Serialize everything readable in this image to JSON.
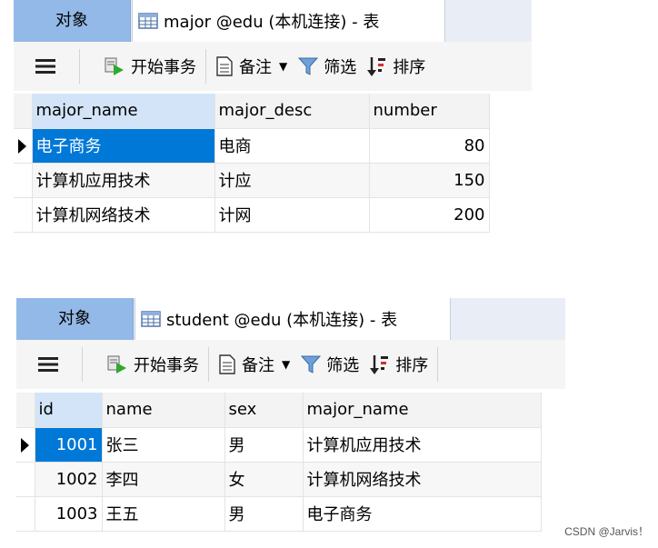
{
  "panel1": {
    "objects_tab": "对象",
    "table_tab": "major @edu (本机连接) - 表",
    "toolbar": {
      "begin_transaction": "开始事务",
      "notes": "备注",
      "filter": "筛选",
      "sort": "排序"
    },
    "columns": [
      "major_name",
      "major_desc",
      "number"
    ],
    "rows": [
      [
        "电子商务",
        "电商",
        "80"
      ],
      [
        "计算机应用技术",
        "计应",
        "150"
      ],
      [
        "计算机网络技术",
        "计网",
        "200"
      ]
    ]
  },
  "panel2": {
    "objects_tab": "对象",
    "table_tab": "student @edu (本机连接) - 表",
    "toolbar": {
      "begin_transaction": "开始事务",
      "notes": "备注",
      "filter": "筛选",
      "sort": "排序"
    },
    "columns": [
      "id",
      "name",
      "sex",
      "major_name"
    ],
    "rows": [
      [
        "1001",
        "张三",
        "男",
        "计算机应用技术"
      ],
      [
        "1002",
        "李四",
        "女",
        "计算机网络技术"
      ],
      [
        "1003",
        "王五",
        "男",
        "电子商务"
      ]
    ]
  },
  "watermark": "CSDN @Jarvis！",
  "colors": {
    "tab_active": "#93b9e8",
    "selection": "#0078d7",
    "header_selected": "#d3e4f8"
  }
}
